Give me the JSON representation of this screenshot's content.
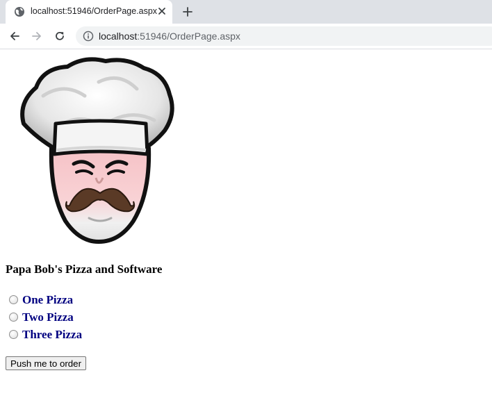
{
  "browser": {
    "tab_title": "localhost:51946/OrderPage.aspx",
    "url_host": "localhost",
    "url_rest": ":51946/OrderPage.aspx"
  },
  "page": {
    "heading": "Papa Bob's Pizza and Software",
    "options": [
      {
        "label": "One Pizza",
        "selected": false
      },
      {
        "label": "Two Pizza",
        "selected": false
      },
      {
        "label": "Three Pizza",
        "selected": false
      }
    ],
    "order_button": "Push me to order"
  }
}
